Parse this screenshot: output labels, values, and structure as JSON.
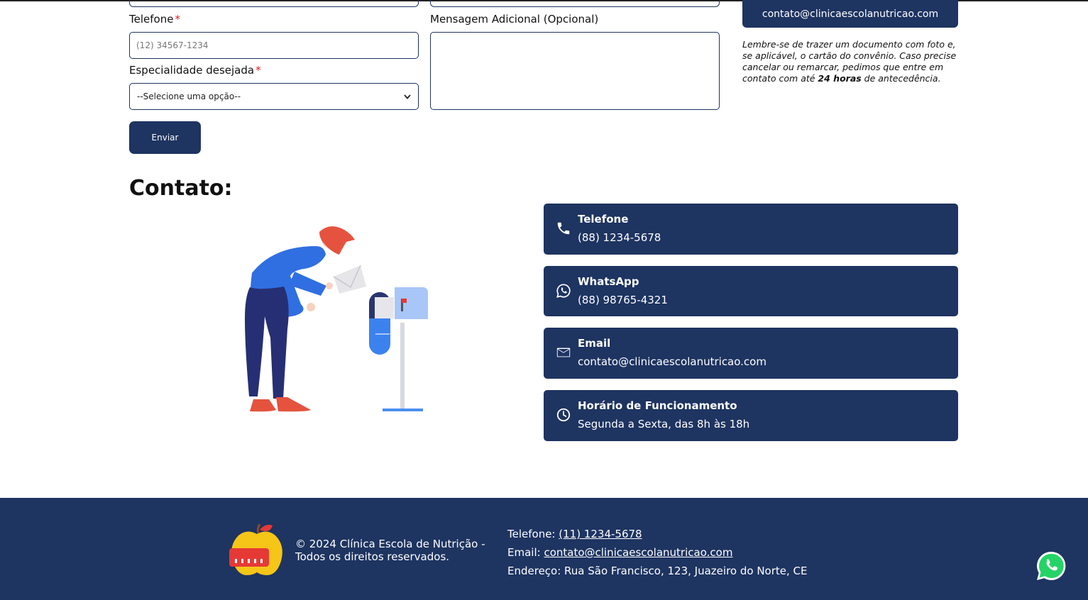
{
  "form": {
    "phone_label": "Telefone",
    "phone_required": "*",
    "phone_placeholder": "(12) 34567-1234",
    "specialty_label": "Especialidade desejada",
    "specialty_required": "*",
    "specialty_selected": "--Selecione uma opção--",
    "message_label": "Mensagem Adicional (Opcional)",
    "submit_label": "Enviar"
  },
  "sidebar": {
    "email_button": "contato@clinicaescolanutricao.com",
    "note_part1": "Lembre-se de trazer um documento com foto e, se aplicável, o cartão do convênio. Caso precise cancelar ou remarcar, pedimos que entre em contato com até ",
    "note_bold": "24 horas",
    "note_part2": " de antecedência."
  },
  "contact": {
    "title": "Contato:",
    "cards": [
      {
        "icon": "phone-icon",
        "title": "Telefone",
        "value": "(88) 1234-5678"
      },
      {
        "icon": "whatsapp-icon",
        "title": "WhatsApp",
        "value": "(88) 98765-4321"
      },
      {
        "icon": "mail-icon",
        "title": "Email",
        "value": "contato@clinicaescolanutricao.com"
      },
      {
        "icon": "clock-icon",
        "title": "Horário de Funcionamento",
        "value": "Segunda a Sexta, das 8h às 18h"
      }
    ]
  },
  "footer": {
    "copyright": "© 2024 Clínica Escola de Nutrição - Todos os direitos reservados.",
    "phone_label": "Telefone:",
    "phone_value": "(11) 1234-5678",
    "email_label": "Email:",
    "email_value": "contato@clinicaescolanutricao.com",
    "address": "Endereço: Rua São Francisco, 123, Juazeiro do Norte, CE"
  },
  "colors": {
    "primary": "#1e3461",
    "required": "#e02020",
    "whatsapp": "#25d366"
  }
}
